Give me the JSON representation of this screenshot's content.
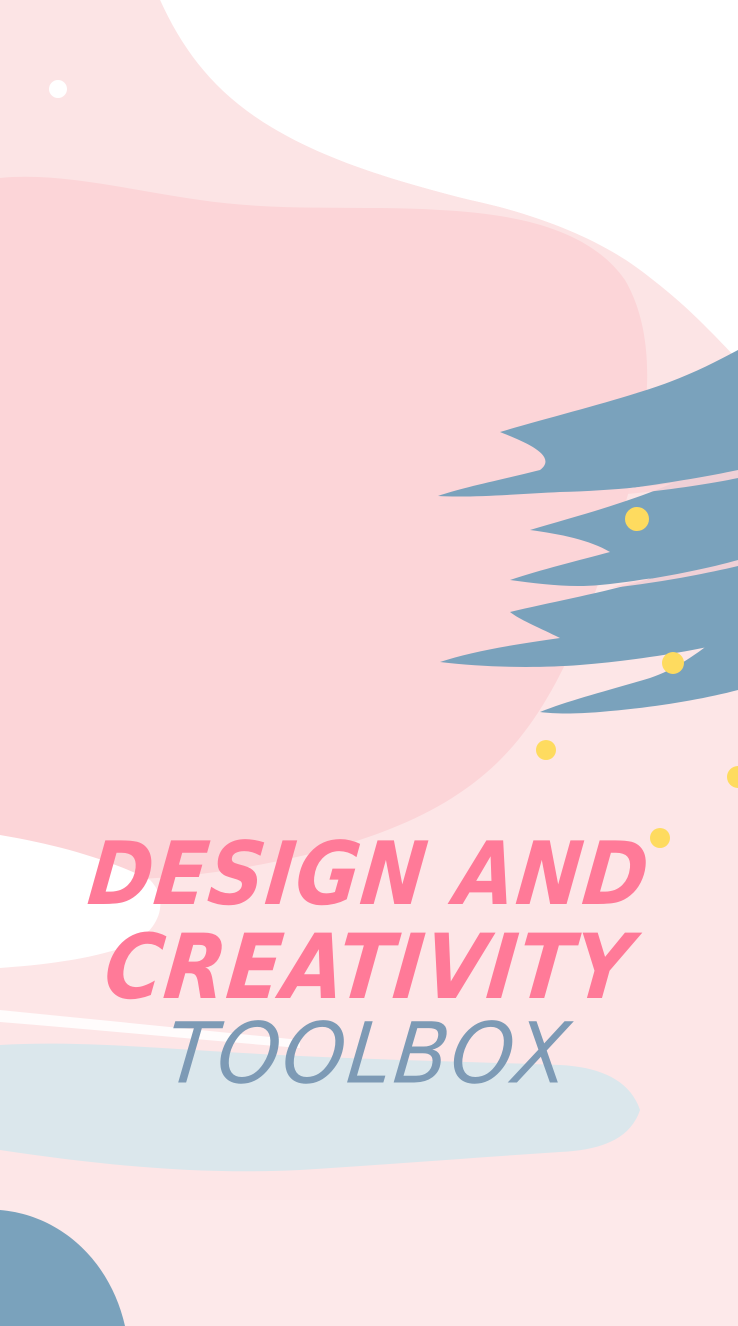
{
  "title": {
    "line1": "DESIGN AND",
    "line2": "CREATIVITY",
    "line3": "TOOLBOX"
  },
  "colors": {
    "page_background": "#fde6e7",
    "pink_blob": "#fcd5d8",
    "light_pink_blob": "#fce4e5",
    "white_area": "#ffffff",
    "steel_blue": "#7aa2bc",
    "pale_blue": "#dbe7ec",
    "yellow_dot": "#fedb5f",
    "title_pink": "#ff7a98",
    "title_blue": "#7d9ab5"
  }
}
